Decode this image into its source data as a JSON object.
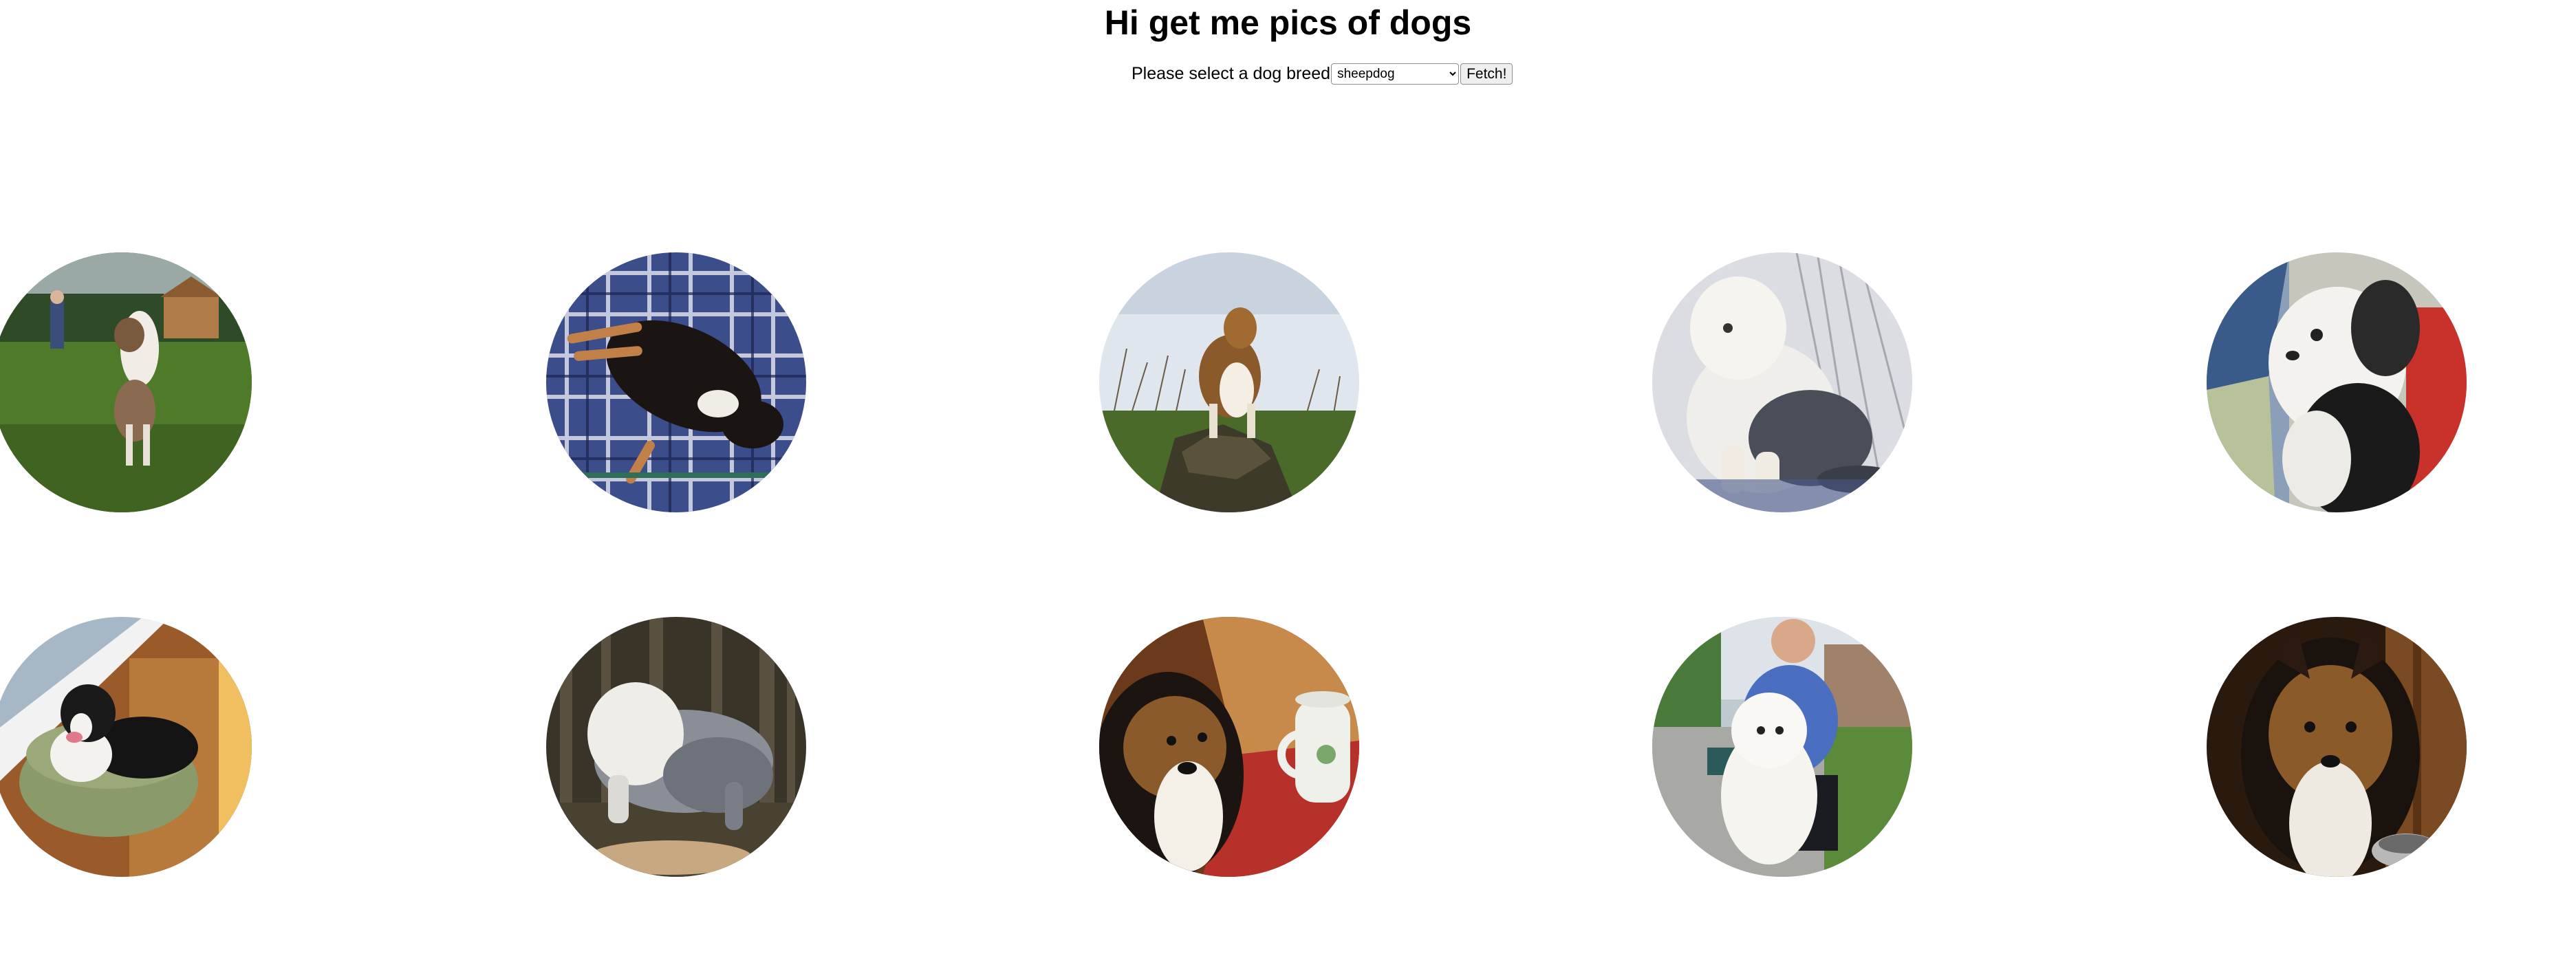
{
  "header": {
    "title": "Hi get me pics of dogs"
  },
  "form": {
    "label": "Please select a dog breed",
    "selected_breed": "sheepdog",
    "fetch_label": "Fetch!"
  },
  "gallery": {
    "images": [
      {
        "name": "dog-photo-1",
        "description": "australian shepherd standing on grass"
      },
      {
        "name": "dog-photo-2",
        "description": "black tricolor dog lying on plaid blanket"
      },
      {
        "name": "dog-photo-3",
        "description": "sable collie on rock in field"
      },
      {
        "name": "dog-photo-4",
        "description": "old english sheepdog sitting in snow"
      },
      {
        "name": "dog-photo-5",
        "description": "black and white sheepdog close-up"
      },
      {
        "name": "dog-photo-6",
        "description": "border collie on dog bed"
      },
      {
        "name": "dog-photo-7",
        "description": "grey sheepdog in forest"
      },
      {
        "name": "dog-photo-8",
        "description": "sheltie next to mug"
      },
      {
        "name": "dog-photo-9",
        "description": "man kneeling with white sheepdog in garden"
      },
      {
        "name": "dog-photo-10",
        "description": "sheltie portrait indoors"
      }
    ]
  }
}
